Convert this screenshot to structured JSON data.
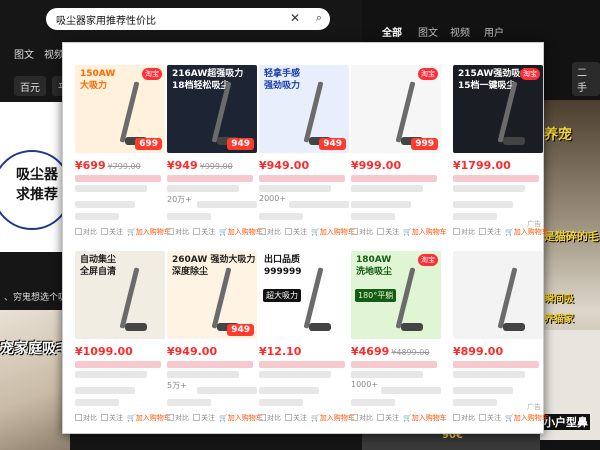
{
  "left_app": {
    "search_query": "吸尘器家用推荐性价比",
    "tabs": [
      "图文",
      "视频"
    ],
    "filters": [
      "百元",
      "平"
    ],
    "headline_line1": "吸尘器",
    "headline_line2": "求推荐",
    "caption": "、穷鬼想选个吸尘器…",
    "photo_text": "宠家庭吸毛"
  },
  "right_app": {
    "tabs": [
      "全部",
      "图文",
      "视频",
      "用户"
    ],
    "active_tab": "全部",
    "chip": "二手",
    "overlay_text_1": "养宠",
    "overlay_text_2": "是猫碎的毛",
    "overlay_text_3": "瞬间吸",
    "overlay_text_4": "养猫家",
    "overlay_text_5": "小户型鼻",
    "strip_text": "90€"
  },
  "panel": {
    "ad_label": "广告",
    "actions": [
      "对比",
      "关注",
      "加入购物车"
    ],
    "products": [
      {
        "headline1": "150AW",
        "headline2": "大吸力",
        "tag": "",
        "price": "¥699",
        "was": "¥799.00",
        "sold": "",
        "shop": "",
        "badge": "淘宝",
        "mini": "",
        "pbox": "699",
        "bg": "#fff1dc",
        "fg": "#ff6a00"
      },
      {
        "headline1": "216AW超强吸力",
        "headline2": "18档轻松吸尘",
        "tag": "",
        "price": "¥949",
        "was": "¥999.00",
        "sold": "20万+",
        "shop": "",
        "badge": "",
        "mini": "",
        "pbox": "949",
        "bg": "#1d2433",
        "fg": "#ffffff"
      },
      {
        "headline1": "轻拿手感",
        "headline2": "强劲吸力",
        "tag": "",
        "price": "¥949.00",
        "was": "",
        "sold": "2000+",
        "shop": "",
        "badge": "",
        "mini": "",
        "pbox": "949",
        "bg": "#e8eefc",
        "fg": "#1a3fa8"
      },
      {
        "headline1": "",
        "headline2": "",
        "tag": "",
        "price": "¥999.00",
        "was": "",
        "sold": "",
        "shop": "",
        "badge": "淘宝",
        "mini": "",
        "pbox": "999",
        "bg": "#f6f6f6",
        "fg": "#333333"
      },
      {
        "headline1": "215AW强劲吸力",
        "headline2": "15档一键吸尘",
        "tag": "",
        "price": "¥1799.00",
        "was": "",
        "sold": "",
        "shop": "",
        "badge": "淘宝",
        "mini": "",
        "pbox": "",
        "bg": "#1b1d24",
        "fg": "#ffffff"
      },
      {
        "headline1": "自动集尘",
        "headline2": "全屏自清",
        "tag": "",
        "price": "¥1099.00",
        "was": "",
        "sold": "",
        "shop": "",
        "badge": "",
        "mini": "",
        "pbox": "",
        "bg": "#f2ede3",
        "fg": "#222222"
      },
      {
        "headline1": "260AW 强劲大吸力",
        "headline2": "深度除尘",
        "tag": "",
        "price": "¥949.00",
        "was": "",
        "sold": "5万+",
        "shop": "",
        "badge": "",
        "mini": "",
        "pbox": "949",
        "bg": "#fff4e3",
        "fg": "#222222"
      },
      {
        "headline1": "出口品质",
        "headline2": "999999",
        "tag": "超大吸力",
        "price": "¥12.10",
        "was": "",
        "sold": "",
        "shop": "",
        "badge": "",
        "mini": "",
        "pbox": "",
        "bg": "#ffffff",
        "fg": "#111111"
      },
      {
        "headline1": "180AW",
        "headline2": "洗地吸尘",
        "tag": "180°平躺",
        "price": "¥4699",
        "was": "¥4899.00",
        "sold": "1000+",
        "shop": "",
        "badge": "淘宝",
        "mini": "",
        "pbox": "",
        "bg": "#dff5d3",
        "fg": "#155d14"
      },
      {
        "headline1": "",
        "headline2": "",
        "tag": "",
        "price": "¥899.00",
        "was": "",
        "sold": "",
        "shop": "",
        "badge": "",
        "mini": "",
        "pbox": "",
        "bg": "#f3f3f3",
        "fg": "#333333"
      }
    ]
  }
}
